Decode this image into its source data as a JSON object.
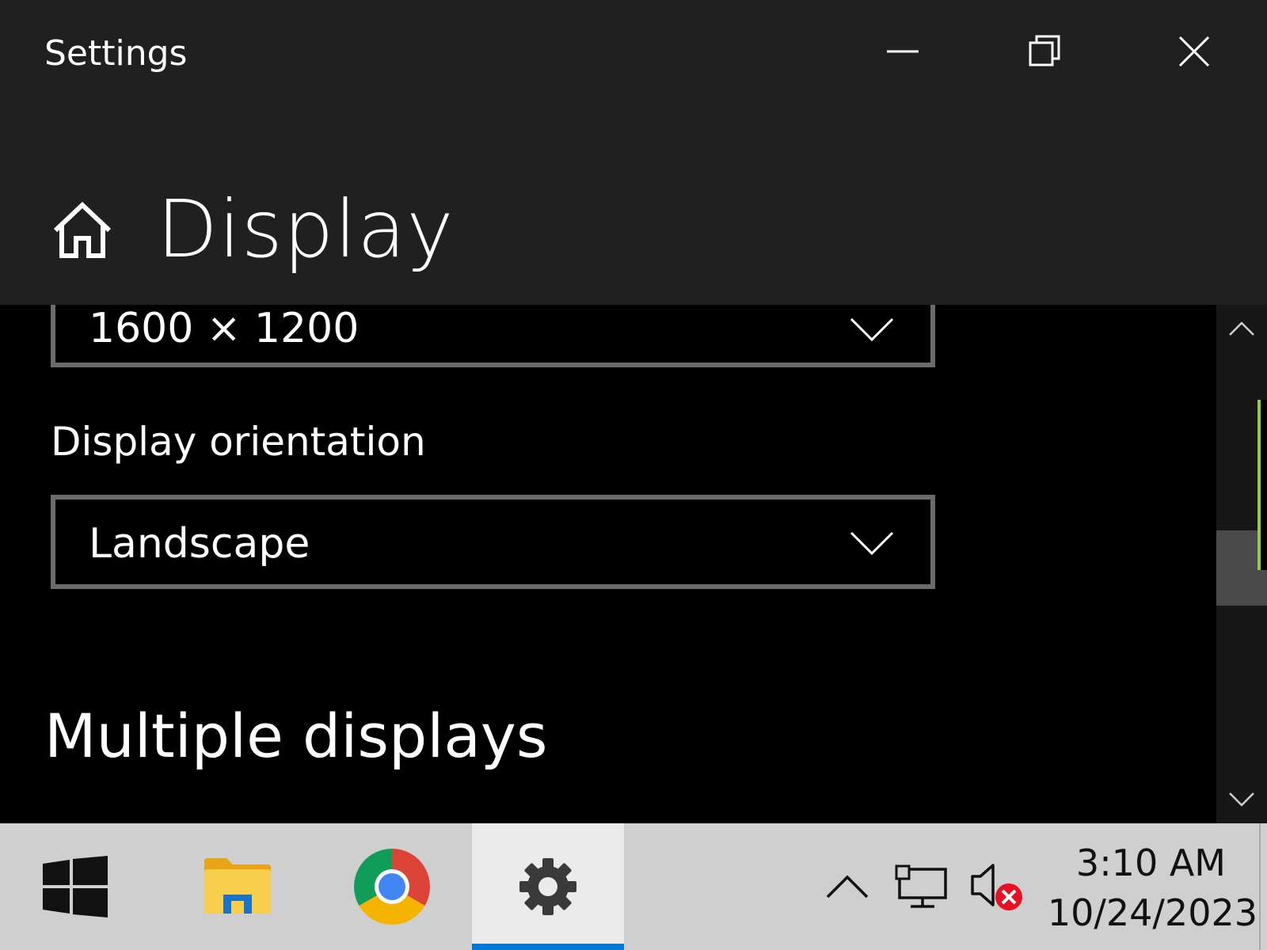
{
  "window": {
    "app_title": "Settings",
    "controls": {
      "minimize": "minimize-icon",
      "restore": "restore-icon",
      "close": "close-icon"
    }
  },
  "header": {
    "home_icon": "home-icon",
    "page_title": "Display"
  },
  "content": {
    "resolution_dropdown": {
      "value": "1600 × 1200",
      "icon": "chevron-down-icon"
    },
    "orientation_label": "Display orientation",
    "orientation_dropdown": {
      "value": "Landscape",
      "icon": "chevron-down-icon"
    },
    "multiple_displays_heading": "Multiple displays"
  },
  "taskbar": {
    "apps": [
      {
        "name": "Start",
        "icon": "windows-logo-icon"
      },
      {
        "name": "File Explorer",
        "icon": "folder-icon"
      },
      {
        "name": "Google Chrome",
        "icon": "chrome-icon"
      },
      {
        "name": "Settings",
        "icon": "gear-icon",
        "active": true
      }
    ],
    "tray": {
      "overflow_icon": "chevron-up-icon",
      "network_icon": "network-icon",
      "volume_icon": "volume-muted-icon"
    },
    "clock": {
      "time": "3:10 AM",
      "date": "10/24/2023"
    }
  },
  "colors": {
    "titlebar": "#202020",
    "content_bg": "#000000",
    "dropdown_border": "#6b6b6b",
    "taskbar_bg": "#cfcfcf",
    "active_indicator": "#0078d7",
    "mute_badge": "#e81123"
  }
}
